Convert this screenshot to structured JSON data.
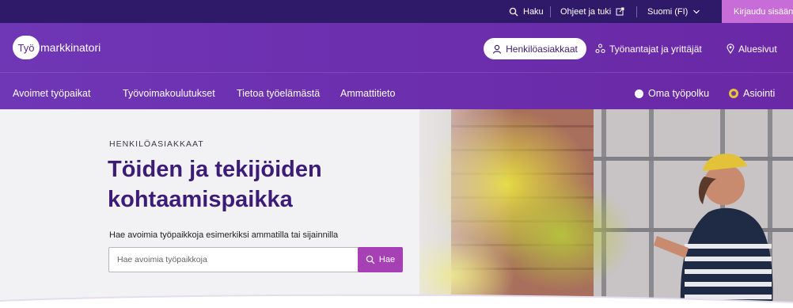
{
  "utility": {
    "search_label": "Haku",
    "help_label": "Ohjeet ja tuki",
    "language_label": "Suomi (FI)",
    "login_label": "Kirjaudu sisään"
  },
  "header": {
    "logo_bubble": "Työ",
    "logo_rest": "markkinatori",
    "audience_active": "Henkilöasiakkaat",
    "audience_employers": "Työnantajat ja yrittäjät",
    "regional": "Aluesivut"
  },
  "nav": {
    "items": [
      {
        "label": "Avoimet työpaikat"
      },
      {
        "label": "Työvoimakoulutukset"
      },
      {
        "label": "Tietoa työelämästä"
      },
      {
        "label": "Ammattitieto"
      }
    ],
    "my_path": "Oma työpolku",
    "services": "Asiointi"
  },
  "hero": {
    "eyebrow": "HENKILÖASIAKKAAT",
    "headline": "Töiden ja tekijöiden kohtaamispaikka",
    "search_label": "Hae avoimia työpaikkoja esimerkiksi ammatilla tai sijainnilla",
    "search_placeholder": "Hae avoimia työpaikkoja",
    "search_button": "Hae"
  },
  "colors": {
    "utility_bar": "#2f1a6a",
    "header": "#6c2fae",
    "login_bg": "#c86dd7",
    "headline": "#3d1c78",
    "search_button": "#a73fb5"
  }
}
